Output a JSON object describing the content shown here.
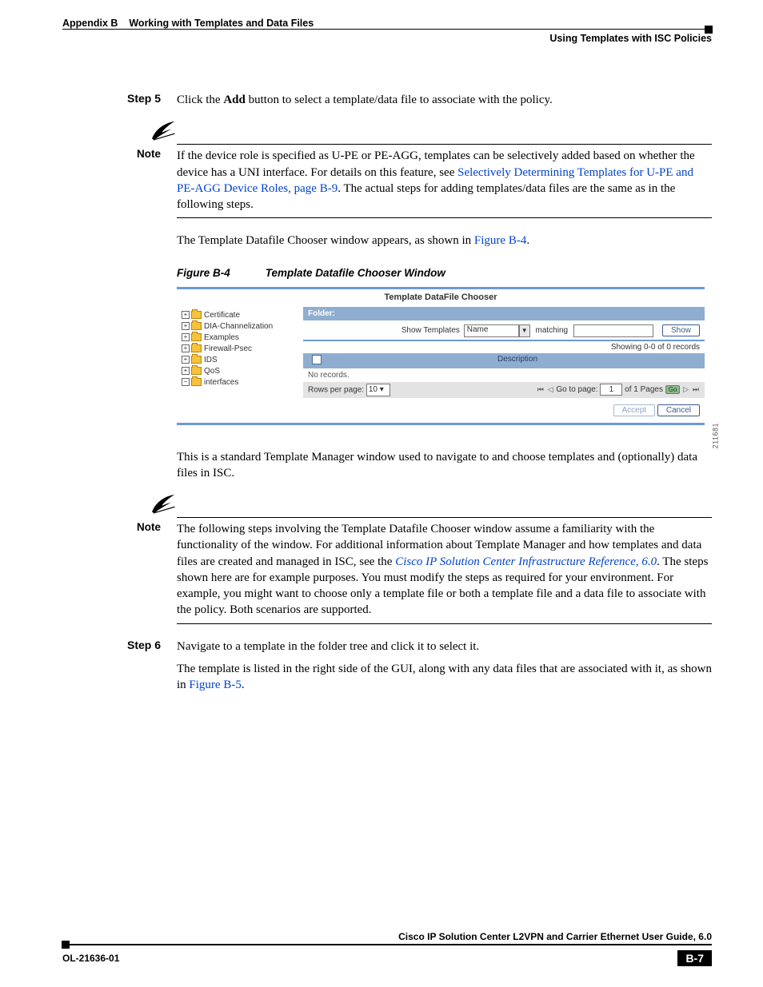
{
  "header": {
    "appendix": "Appendix B",
    "chapter": "Working with Templates and Data Files",
    "section": "Using Templates with ISC Policies"
  },
  "step5": {
    "label": "Step 5",
    "pre": "Click the ",
    "bold": "Add",
    "post": " button to select a template/data file to associate with the policy."
  },
  "note1": {
    "label": "Note",
    "t1": "If the device role is specified as U-PE or PE-AGG, templates can be selectively added based on whether the device has a UNI interface. For details on this feature, see ",
    "link": "Selectively Determining Templates for U-PE and PE-AGG Device Roles, page B-9",
    "t2": ". The actual steps for adding templates/data files are the same as in the following steps."
  },
  "para_after_note1": {
    "t1": "The Template Datafile Chooser window appears, as shown in ",
    "link": "Figure B-4",
    "t2": "."
  },
  "figcap": {
    "num": "Figure B-4",
    "title": "Template Datafile Chooser Window"
  },
  "figure": {
    "title": "Template DataFile Chooser",
    "folder_label": "Folder:",
    "tree": [
      "Certificate",
      "DIA-Channelization",
      "Examples",
      "Firewall-Psec",
      "IDS",
      "QoS",
      "interfaces"
    ],
    "show_label": "Show Templates",
    "show_name": "Name",
    "matching": "matching",
    "show_btn": "Show",
    "count": "Showing 0-0 of 0 records",
    "desc": "Description",
    "norec": "No records.",
    "rows_lbl": "Rows per page:",
    "rows_val": "10",
    "goto": "Go to page:",
    "page_val": "1",
    "of_pages": "of 1 Pages",
    "go": "Go",
    "accept": "Accept",
    "cancel": "Cancel",
    "side_num": "211681"
  },
  "para_std_mgr": "This is a standard Template Manager window used to navigate to and choose templates and (optionally) data files in ISC.",
  "note2": {
    "label": "Note",
    "t1": "The following steps involving the Template Datafile Chooser window assume a familiarity with the functionality of the window. For additional information about Template Manager and how templates and data files are created and managed in ISC, see the ",
    "link": "Cisco IP Solution Center Infrastructure Reference, 6.0",
    "t2": ". The steps shown here are for example purposes. You must modify the steps as required for your environment. For example, you might want to choose only a template file or both a template file and a data file to associate with the policy. Both scenarios are supported."
  },
  "step6": {
    "label": "Step 6",
    "line1": "Navigate to a template in the folder tree and click it to select it.",
    "line2a": "The template is listed in the right side of the GUI, along with any data files that are associated with it, as shown in ",
    "line2link": "Figure B-5",
    "line2b": "."
  },
  "footer": {
    "book": "Cisco IP Solution Center L2VPN and Carrier Ethernet User Guide, 6.0",
    "ol": "OL-21636-01",
    "page": "B-7"
  }
}
